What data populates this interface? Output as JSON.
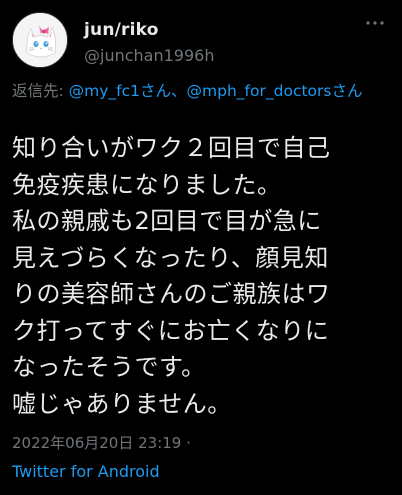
{
  "author": {
    "display_name": "jun/riko",
    "handle": "@junchan1996h"
  },
  "reply_to": {
    "prefix": "返信先: ",
    "mention_1": "@my_fc1さん",
    "separator": "、",
    "mention_2": "@mph_for_doctorsさん"
  },
  "tweet": {
    "lines": [
      "知り合いがワク２回目で自己",
      "免疫疾患になりました。",
      "私の親戚も2回目で目が急に",
      "見えづらくなったり、顔見知",
      "りの美容師さんのご親族はワ",
      "ク打ってすぐにお亡くなりに",
      "なったそうです。",
      "嘘じゃありません。"
    ]
  },
  "meta": {
    "timestamp": "2022年06月20日 23:19 ·",
    "source": "Twitter for Android"
  },
  "icons": {
    "avatar": "cat-avatar",
    "more": "more-options-icon"
  },
  "colors": {
    "background": "#000000",
    "text": "#e7e9ea",
    "secondary": "#71767b",
    "accent": "#1d9bf0"
  }
}
